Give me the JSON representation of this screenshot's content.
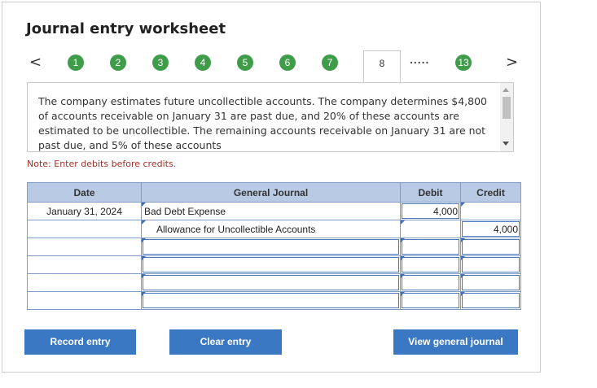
{
  "title": "Journal entry worksheet",
  "nav": {
    "prev_icon": "chevron-left-icon",
    "next_icon": "chevron-right-icon",
    "prev_glyph": "<",
    "next_glyph": ">",
    "steps": [
      "1",
      "2",
      "3",
      "4",
      "5",
      "6",
      "7"
    ],
    "current": "8",
    "ellipsis": ".....",
    "last": "13"
  },
  "scenario": {
    "text": "The company estimates future uncollectible accounts. The company determines $4,800 of accounts receivable on January 31 are past due, and 20% of these accounts are estimated to be uncollectible. The remaining accounts receivable on January 31 are not past due, and 5% of these accounts"
  },
  "note": "Note: Enter debits before credits.",
  "table": {
    "headers": {
      "date": "Date",
      "account": "General Journal",
      "debit": "Debit",
      "credit": "Credit"
    },
    "rows": [
      {
        "date": "January 31, 2024",
        "account": "Bad Debt Expense",
        "debit": "4,000",
        "credit": ""
      },
      {
        "date": "",
        "account": "Allowance for Uncollectible Accounts",
        "debit": "",
        "credit": "4,000"
      },
      {
        "date": "",
        "account": "",
        "debit": "",
        "credit": ""
      },
      {
        "date": "",
        "account": "",
        "debit": "",
        "credit": ""
      },
      {
        "date": "",
        "account": "",
        "debit": "",
        "credit": ""
      },
      {
        "date": "",
        "account": "",
        "debit": "",
        "credit": ""
      }
    ]
  },
  "buttons": {
    "record": "Record entry",
    "clear": "Clear entry",
    "view": "View general journal"
  },
  "colors": {
    "accent": "#3a78c3",
    "step": "#3f9d4a",
    "header": "#b9cbe4",
    "note": "#a0322a"
  }
}
